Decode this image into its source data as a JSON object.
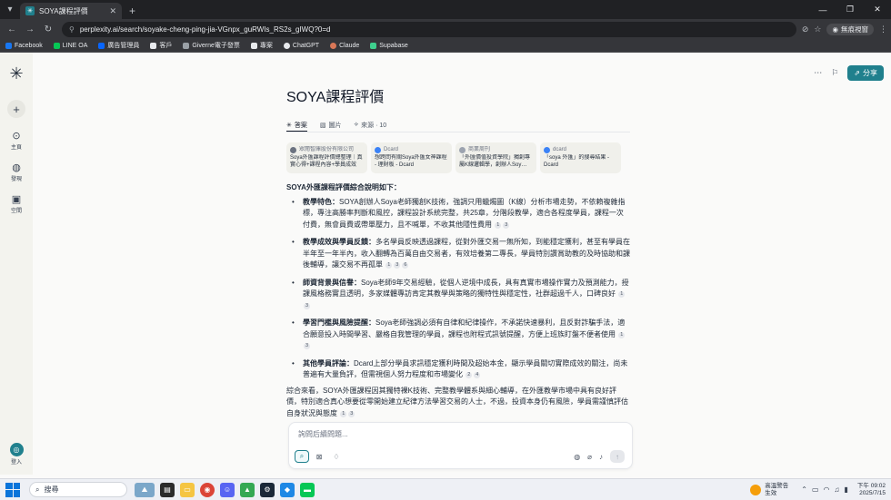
{
  "browser": {
    "tab_title": "SOYA課程評價",
    "tab_icon": "perplexity-icon",
    "url": "perplexity.ai/search/soyake-cheng-ping-jia-VGnpx_guRWIs_RS2s_gIWQ?0=d",
    "profile_label": "無痕視窗",
    "bookmarks": [
      "Facebook",
      "LINE OA",
      "廣告管理員",
      "客戶",
      "Giverne電子發票",
      "專案",
      "ChatGPT",
      "Claude",
      "Supabase"
    ]
  },
  "sidebar": {
    "new_label": "+",
    "items": [
      {
        "label": "主頁",
        "icon": "search-icon"
      },
      {
        "label": "發現",
        "icon": "globe-icon"
      },
      {
        "label": "空間",
        "icon": "spaces-icon"
      }
    ],
    "login_label": "登入"
  },
  "header": {
    "share_label": "分享"
  },
  "page": {
    "title": "SOYA課程評價",
    "tabs": [
      {
        "label": "答案",
        "icon": "perplexity-icon"
      },
      {
        "label": "圖片",
        "icon": "image-icon"
      },
      {
        "label": "來源 · 10",
        "icon": "link-icon"
      }
    ],
    "sources": [
      {
        "site": "眾閱智庫股份有限公司",
        "text": "Soya外匯課程評價總整理｜真實心得+課程內容+學員成效"
      },
      {
        "site": "Dcard",
        "text": "想跨問有關Soya外匯女神課程 - 理財板 - Dcard"
      },
      {
        "site": "商業周刊",
        "text": "「外匯價值投資學院」獨創專屬K線邏輯學，創辦人Soy…"
      },
      {
        "site": "dcard",
        "text": "「soya 外匯」的搜尋結果 - Dcard"
      }
    ],
    "answer": {
      "intro": "SOYA外匯課程評價綜合說明如下：",
      "items": [
        {
          "head": "教學特色：",
          "body": "SOYA創辦人Soya老師獨創K技術，強調只用蠟燭圖（K線）分析市場走勢，不依賴複雜指標，專注高勝率判斷和風控，課程設計系統完整，共25章，分階段教學，適合各程度學員，課程一次付費，無會員費或帶單壓力，且不喊單，不收其他隱性費用",
          "cites": [
            "1",
            "3"
          ]
        },
        {
          "head": "教學成效與學員反饋：",
          "body": "多名學員反映透過課程，從對外匯交易一無所知，到能穩定獲利，甚至有學員在半年至一年半內，收入翻轉為百萬自由交易者，有效培養第二專長，學員特別讚賞助教的及時協助和課後輔導，讓交易不再孤單",
          "cites": [
            "1",
            "3",
            "6"
          ]
        },
        {
          "head": "師資背景與信譽：",
          "body": "Soya老師9年交易經驗，從個人逆境中成長，具有真實市場操作實力及預測能力，授課風格務實且透明，多家媒體專訪肯定其教學與策略的獨特性與穩定性，社群超過千人，口碑良好",
          "cites": [
            "1",
            "3"
          ]
        },
        {
          "head": "學習門檻與風險提醒：",
          "body": "Soya老師強調必須有自律和紀律操作，不承諾快速暴利，且反對詐騙手法，適合願意投入時間學習、嚴格自我管理的學員，課程也附程式訊號提醒，方便上班族盯盤不便者使用",
          "cites": [
            "1",
            "3"
          ]
        },
        {
          "head": "其他學員評論：",
          "body": "Dcard上部分學員求訊穩定獲利時間及超始本金，顯示學員關切實際成效的關注，尚未普遍有大量負評，但需視個人努力程度和市場變化",
          "cites": [
            "2",
            "4"
          ]
        }
      ],
      "summary": "綜合來看，SOYA外匯課程因其獨特裸K技術、完整教學體系與細心輔導，在外匯教學市場中具有良好評價，特別適合真心想要從零開始建立紀律方法學習交易的人士，不過，投資本身仍有風險，學員需謹慎評估自身狀況與態度",
      "summary_cites": [
        "1",
        "3"
      ]
    },
    "ask_placeholder": "詢問后續問題..."
  },
  "taskbar": {
    "search_label": "搜尋",
    "weather_title": "高溫警告",
    "weather_sub": "生效",
    "time": "下午 09:02",
    "date": "2025/7/15"
  },
  "colors": {
    "accent": "#20808d",
    "chrome_dark": "#202124",
    "chrome_mid": "#35363a"
  }
}
